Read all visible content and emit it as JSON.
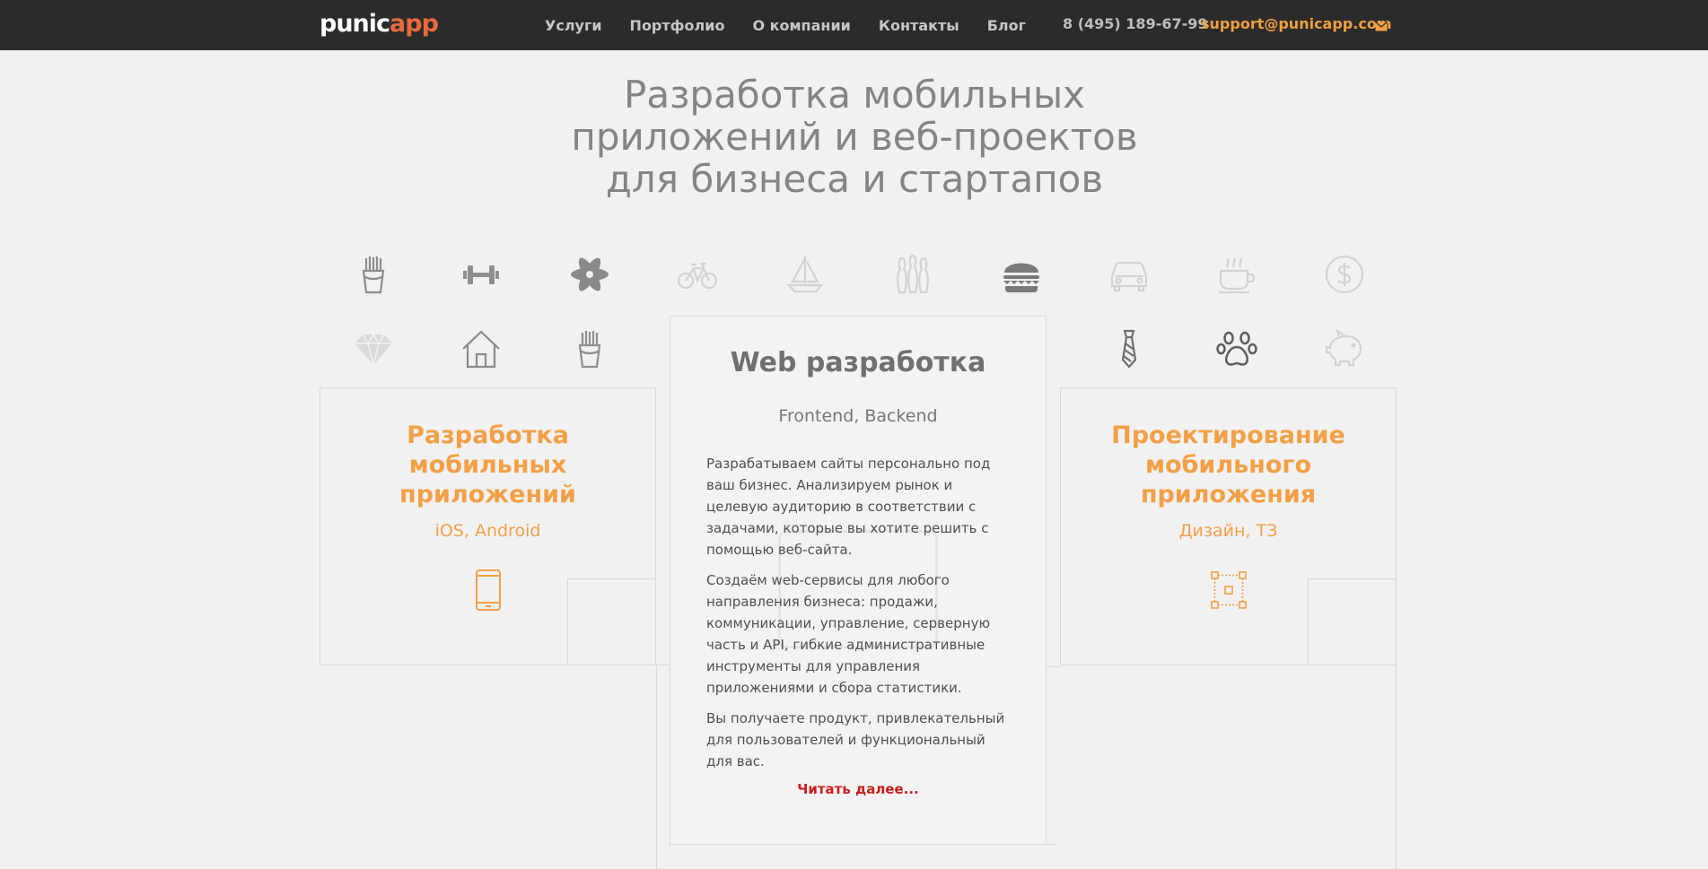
{
  "header": {
    "logo_part1": "punic",
    "logo_part2": "app",
    "nav": [
      "Услуги",
      "Портфолио",
      "О компании",
      "Контакты",
      "Блог"
    ],
    "phone": "8 (495) 189-67-99",
    "email": "support@punicapp.com"
  },
  "hero": {
    "title_lines": [
      "Разработка мобильных",
      "приложений и веб-проектов",
      "для бизнеса и стартапов"
    ]
  },
  "icons": {
    "row1": [
      "fries-icon",
      "dumbbell-icon",
      "atom-icon",
      "bicycle-icon",
      "sailboat-icon",
      "bowling-pins-icon",
      "burger-icon",
      "car-icon",
      "coffee-cup-icon",
      "dollar-coin-icon"
    ],
    "row2": [
      "diamond-icon",
      "house-icon",
      "fries-icon",
      "necktie-icon",
      "paw-icon",
      "piggy-bank-icon"
    ]
  },
  "cards": {
    "left": {
      "title_lines": [
        "Разработка",
        "мобильных",
        "приложений"
      ],
      "subtitle": "iOS, Android",
      "icon": "smartphone-icon"
    },
    "middle": {
      "title": "Web разработка",
      "subtitle": "Frontend, Backend",
      "paragraphs": [
        "Разрабатываем сайты персонально под ваш бизнес. Анализируем рынок и целевую аудиторию в соответствии с задачами, которые вы хотите решить с помощью веб-сайта.",
        "Создаём web-сервисы для любого направления бизнеса: продажи, коммуникации, управление, серверную часть и API, гибкие административные инструменты для управления приложениями и сбора статистики.",
        "Вы получаете продукт, привлекательный для пользователей и функциональный для вас."
      ],
      "read_more": "Читать далее..."
    },
    "right": {
      "title_lines": [
        "Проектирование",
        "мобильного",
        "приложения"
      ],
      "subtitle": "Дизайн, ТЗ",
      "icon": "design-frame-icon"
    }
  },
  "colors": {
    "accent": "#f2a046",
    "logo_accent": "#e86a3e",
    "link_red": "#c8201d",
    "header_bg": "#2b2b2b",
    "page_bg": "#f2f1f2"
  }
}
